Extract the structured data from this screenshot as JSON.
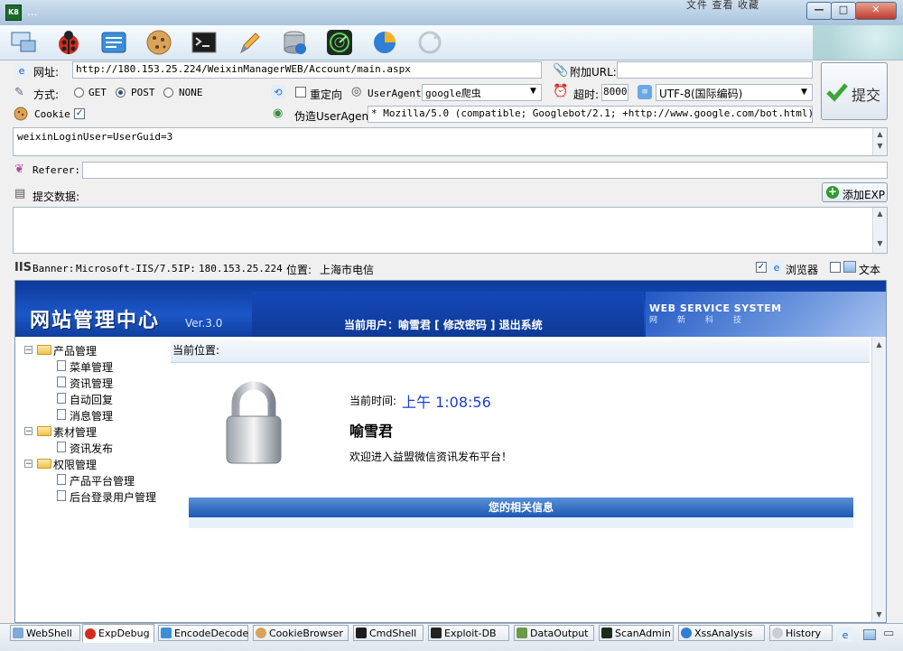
{
  "window": {
    "title": "...",
    "menu_text": "文件   查看   收藏",
    "minimize": "—",
    "maximize": "□",
    "close": "✕"
  },
  "toolbar": {
    "icons": [
      "webshell-icon",
      "ladybug-icon",
      "encode-icon",
      "cookie-icon",
      "cmd-icon",
      "pencil-icon",
      "database-icon",
      "radar-icon",
      "pie-icon",
      "refresh-icon"
    ]
  },
  "form": {
    "url_label": "网址:",
    "url_value": "http://180.153.25.224/WeixinManagerWEB/Account/main.aspx",
    "extra_url_label": "附加URL:",
    "extra_url_value": "",
    "submit_label": "提交",
    "method_label": "方式:",
    "methods": [
      "GET",
      "POST",
      "NONE"
    ],
    "method_selected": "POST",
    "redirect_label": "重定向",
    "useragent_label": "UserAgent:",
    "useragent_value": "google爬虫",
    "timeout_label": "超时:",
    "timeout_value": "8000",
    "encoding_value": "UTF-8(国际编码)",
    "cookie_label": "Cookie",
    "cookie_checked": true,
    "fake_ua_label": "伪造UserAgent:",
    "fake_ua_value": "* Mozilla/5.0 (compatible; Googlebot/2.1; +http://www.google.com/bot.html)",
    "cookie_value": "weixinLoginUser=UserGuid=3",
    "referer_label": "Referer:",
    "referer_value": "",
    "postdata_label": "提交数据:",
    "add_exp_label": "添加EXP",
    "postdata_value": ""
  },
  "status": {
    "banner_label": "Banner:",
    "banner_value": "Microsoft-IIS/7.5",
    "ip_label": "IP:",
    "ip_value": "180.153.25.224",
    "location_label": "位置:",
    "location_value": "上海市电信",
    "browser_label": "浏览器",
    "text_label": "文本"
  },
  "site": {
    "logo": "网站管理中心",
    "version": "Ver.3.0",
    "user_bar": "当前用户：喻雪君 [ 修改密码 ]    退出系统",
    "wss_title": "WEB SERVICE SYSTEM",
    "wss_sub": "网新科技",
    "tree": [
      {
        "label": "产品管理",
        "children": [
          "菜单管理",
          "资讯管理",
          "自动回复",
          "消息管理"
        ]
      },
      {
        "label": "素材管理",
        "children": [
          "资讯发布"
        ]
      },
      {
        "label": "权限管理",
        "children": [
          "产品平台管理",
          "后台登录用户管理"
        ]
      }
    ],
    "crumb": "当前位置:",
    "time_label": "当前时间:",
    "time_value": "上午 1:08:56",
    "username": "喻雪君",
    "welcome": "欢迎进入益盟微信资讯发布平台！",
    "info_title": "您的相关信息"
  },
  "tabs": [
    "WebShell",
    "ExpDebug",
    "EncodeDecode",
    "CookieBrowser",
    "CmdShell",
    "Exploit-DB",
    "DataOutput",
    "ScanAdmin",
    "XssAnalysis",
    "History"
  ],
  "active_tab": "ExpDebug",
  "colors": {
    "accent": "#1c56c8",
    "time": "#1a3ec8",
    "submit_check": "#3fa535"
  }
}
